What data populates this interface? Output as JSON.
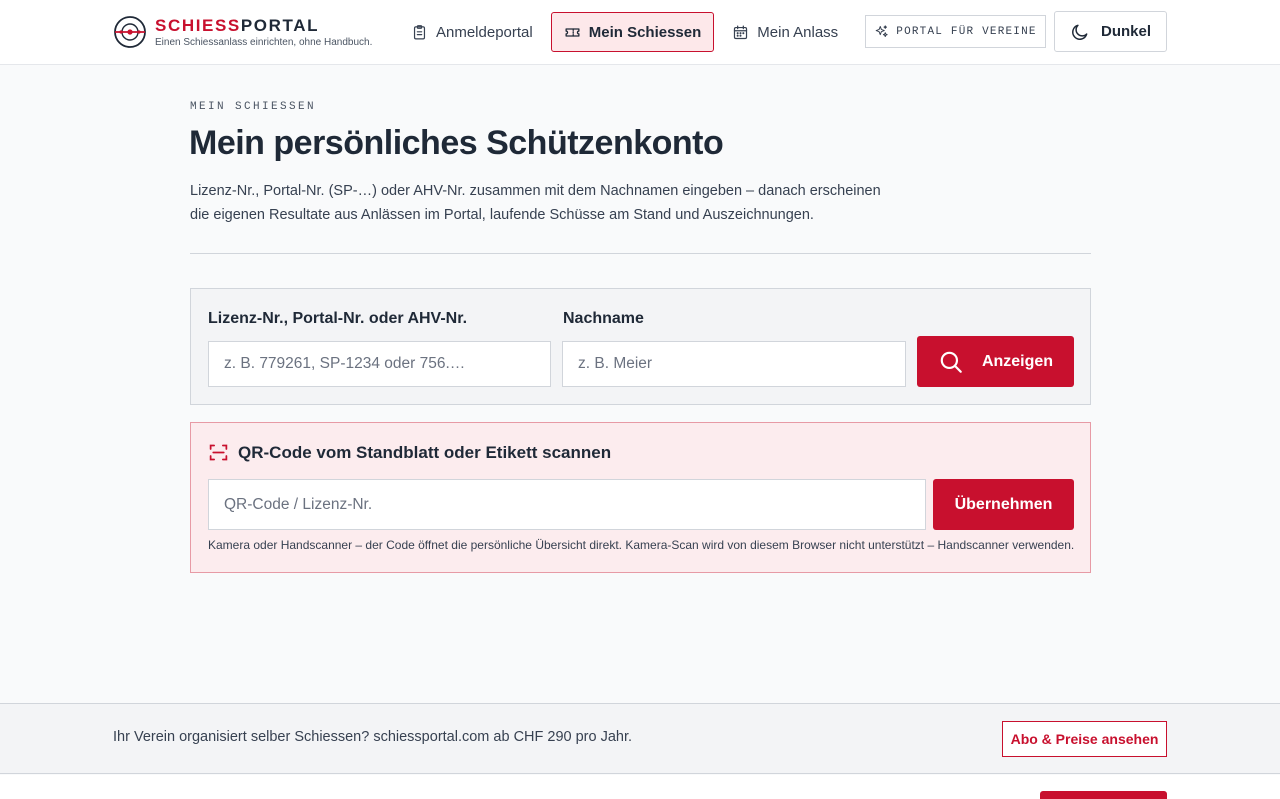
{
  "header": {
    "brand_part1": "SCHIESS",
    "brand_part2": "PORTAL",
    "tagline": "Einen Schiessanlass einrichten, ohne Handbuch.",
    "nav": [
      {
        "label": "Anmeldeportal",
        "icon": "clipboard-icon"
      },
      {
        "label": "Mein Schiessen",
        "icon": "ticket-icon",
        "active": true
      },
      {
        "label": "Mein Anlass",
        "icon": "calendar-icon"
      }
    ],
    "portal_button": "PORTAL FÜR VEREINE",
    "theme_button": "Dunkel"
  },
  "main": {
    "eyebrow": "MEIN SCHIESSEN",
    "title": "Mein persönliches Schützenkonto",
    "intro": "Lizenz-Nr., Portal-Nr. (SP-…) oder AHV-Nr. zusammen mit dem Nachnamen eingeben – danach erscheinen die eigenen Resultate aus Anlässen im Portal, laufende Schüsse am Stand und Auszeichnungen."
  },
  "search": {
    "id_label": "Lizenz-Nr., Portal-Nr. oder AHV-Nr.",
    "id_placeholder": "z. B. 779261, SP-1234 oder 756.…",
    "name_label": "Nachname",
    "name_placeholder": "z. B. Meier",
    "submit_label": "Anzeigen"
  },
  "qr": {
    "title": "QR-Code vom Standblatt oder Etikett scannen",
    "placeholder": "QR-Code / Lizenz-Nr.",
    "submit_label": "Übernehmen",
    "note": "Kamera oder Handscanner – der Code öffnet die persönliche Übersicht direkt. Kamera-Scan wird von diesem Browser nicht unterstützt – Handscanner verwenden."
  },
  "promo": {
    "text": "Ihr Verein organisiert selber Schiessen? schiessportal.com ab CHF 290 pro Jahr.",
    "button": "Abo & Preise ansehen"
  },
  "colors": {
    "accent": "#c8102e",
    "accent_soft": "#fde8ea",
    "background": "#f9fafb"
  }
}
